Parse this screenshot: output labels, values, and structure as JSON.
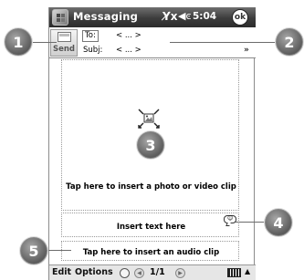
{
  "title_bar": {
    "app_title": "Messaging",
    "signal_icon": "Y̸x",
    "volume_icon": "◀ͼ",
    "time": "5:04",
    "ok_label": "ok"
  },
  "header": {
    "send_label": "Send",
    "to_label": "To:",
    "to_value": "< ... >",
    "subj_label": "Subj:",
    "subj_value": "< ... >",
    "expand_icon": "»"
  },
  "body": {
    "photo_label": "Tap here to insert a photo or video clip",
    "text_label": "Insert text here",
    "audio_label": "Tap here to insert an audio clip"
  },
  "menu_bar": {
    "edit_label": "Edit",
    "options_label": "Options",
    "page_count": "1/1",
    "sip_arrow": "▲"
  },
  "callouts": [
    "1",
    "2",
    "3",
    "4",
    "5"
  ],
  "colors": {
    "title_bar": "#3c3c3c",
    "callout": "#5d5d5d",
    "menu_bar": "#e6e6e6"
  }
}
